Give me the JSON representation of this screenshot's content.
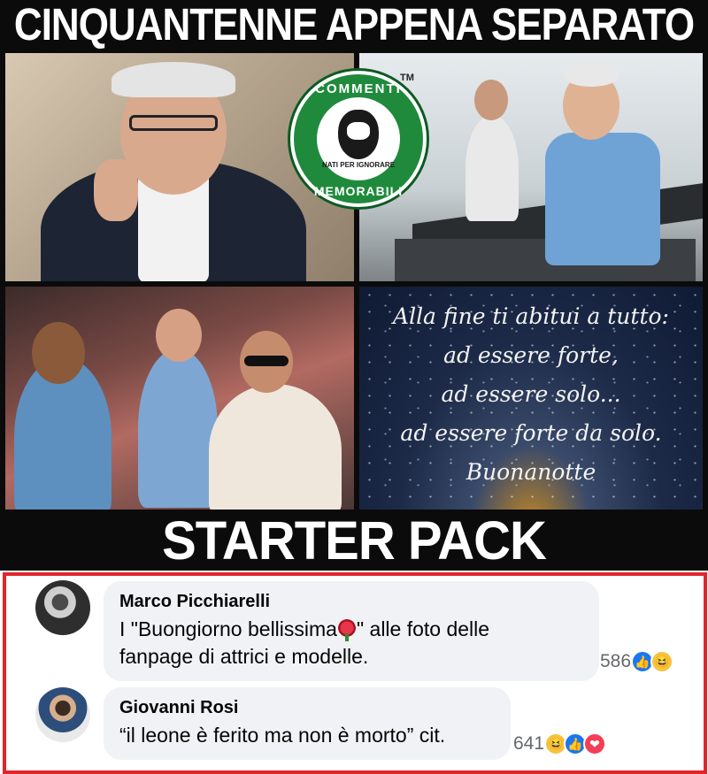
{
  "meme": {
    "title": "CINQUANTENNE APPENA SEPARATO",
    "bottom_title": "STARTER PACK",
    "logo": {
      "top_text": "COMMENTI",
      "bottom_text": "MEMORABILI",
      "sub_text": "NATI PER IGNORARE",
      "trademark": "TM",
      "colors": {
        "ring": "#1f8a3c",
        "inner": "#ffffff"
      }
    },
    "panels": [
      {
        "name": "man-vaping"
      },
      {
        "name": "man-treadmill"
      },
      {
        "name": "man-dancing"
      },
      {
        "name": "quote-card",
        "quote_lines": [
          "Alla fine ti abitui a tutto:",
          "ad essere forte,",
          "ad essere solo...",
          "ad essere forte da solo.",
          "Buonanotte"
        ]
      }
    ]
  },
  "comments": [
    {
      "author": "Marco Picchiarelli",
      "text_before_emoji": "I \"Buongiorno bellissima",
      "text_after_emoji": "\" alle foto delle",
      "text_line2": "fanpage di attrici e modelle.",
      "emoji": "rose-icon",
      "reaction_count": "586",
      "reactions": [
        "like",
        "haha"
      ]
    },
    {
      "author": "Giovanni Rosi",
      "text": "“il leone è ferito ma non è morto” cit.",
      "reaction_count": "641",
      "reactions": [
        "haha",
        "like",
        "love"
      ]
    }
  ],
  "colors": {
    "highlight_border": "#e0262b",
    "bubble": "#f0f2f5",
    "like": "#1877f2",
    "haha": "#f7c23c",
    "love": "#f33e58"
  }
}
